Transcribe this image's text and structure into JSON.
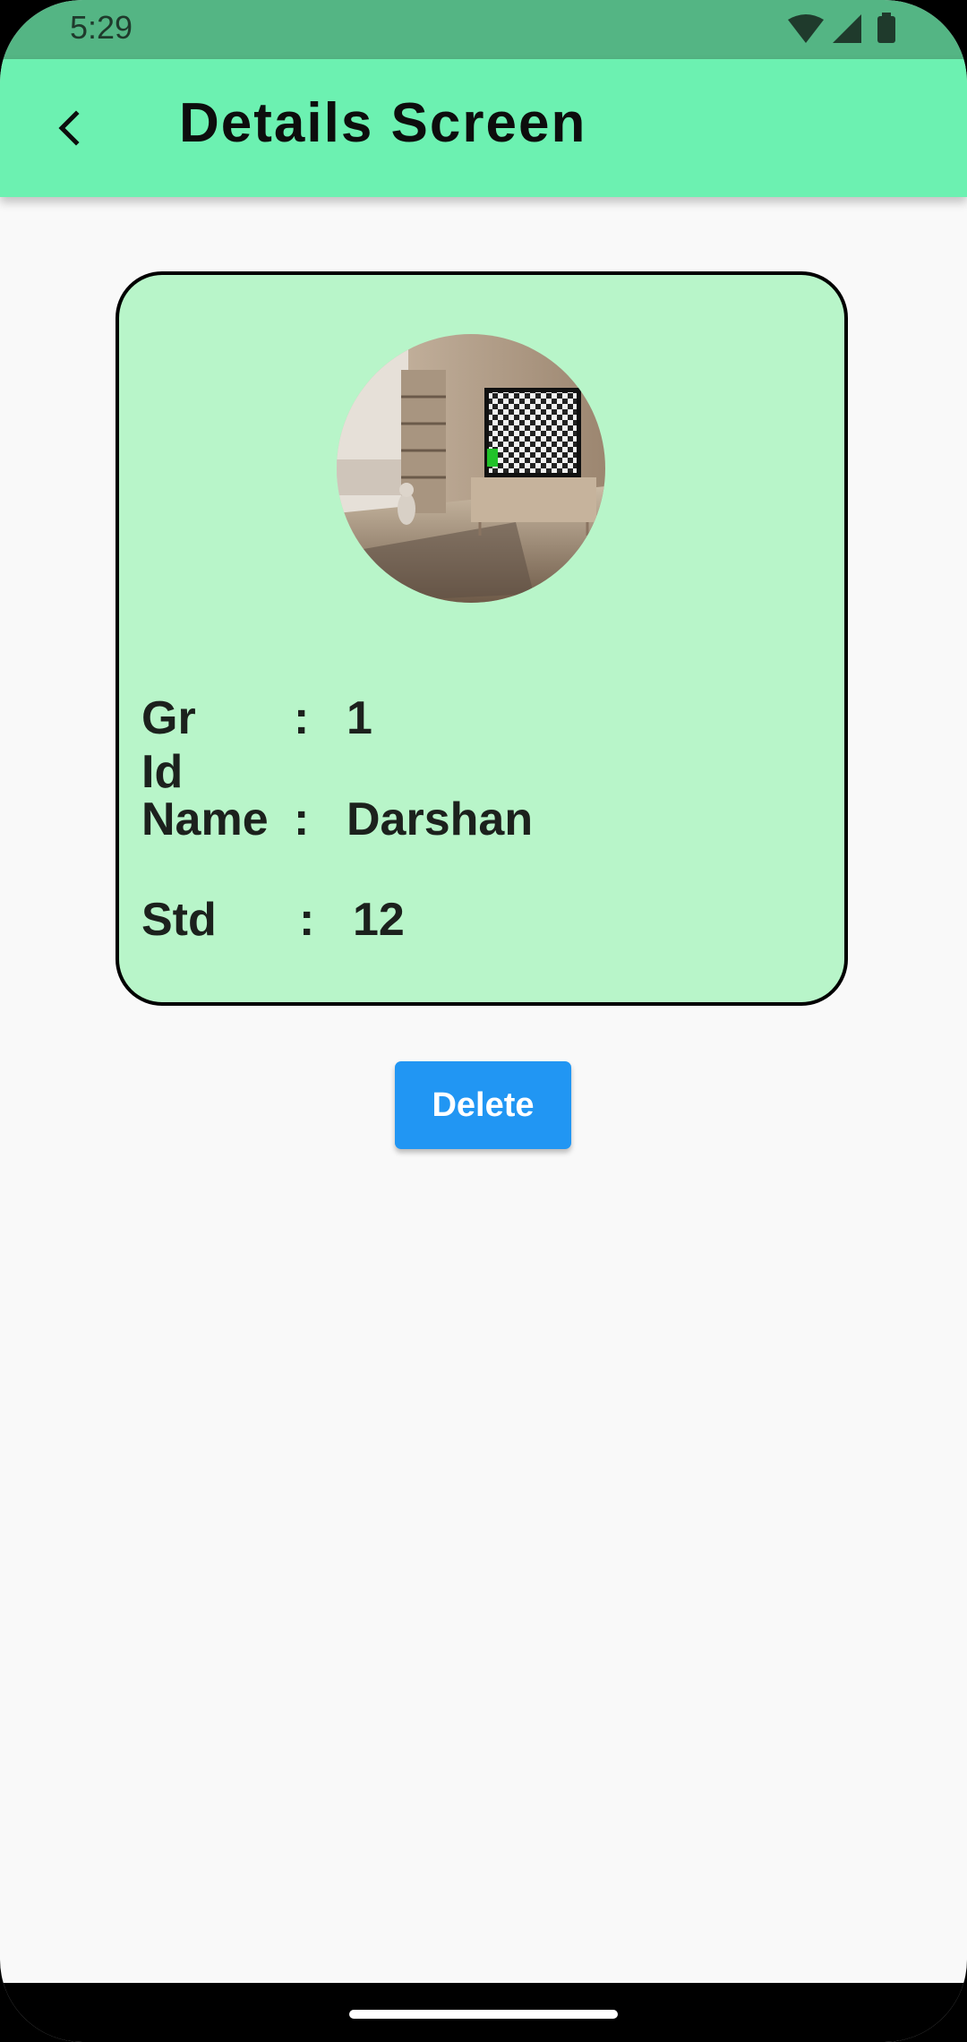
{
  "status_bar": {
    "time": "5:29",
    "icons": [
      "wifi-icon",
      "signal-icon",
      "battery-icon"
    ]
  },
  "app_bar": {
    "title": "Details Screen",
    "back_icon": "chevron-left-icon"
  },
  "card": {
    "avatar_icon": "room-photo",
    "fields": [
      {
        "label": "Gr Id",
        "colon": ":",
        "value": "1"
      },
      {
        "label": "Name",
        "colon": ":",
        "value": "Darshan"
      },
      {
        "label": "Std",
        "colon": ":",
        "value": "12"
      }
    ]
  },
  "actions": {
    "delete_label": "Delete"
  },
  "colors": {
    "status_bar": "#54b584",
    "app_bar": "#6cf1b1",
    "card_background": "#b8f5c9",
    "button": "#2196f3",
    "background": "#f9f9f9"
  }
}
